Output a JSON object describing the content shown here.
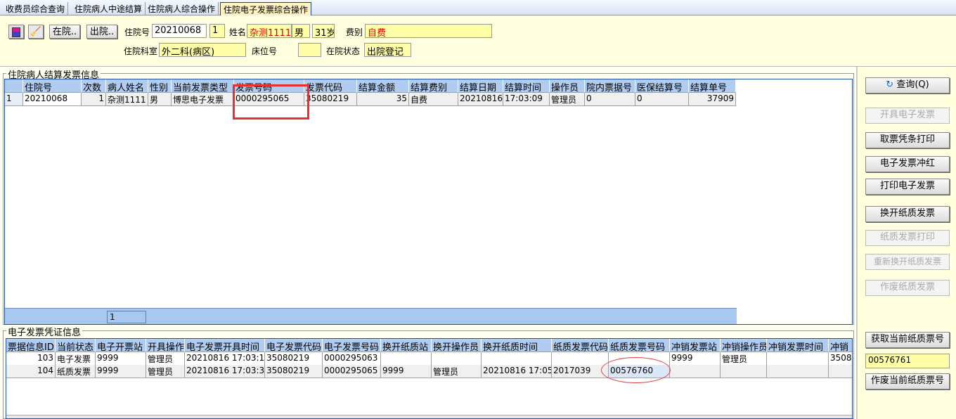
{
  "tabs": [
    "收费员综合查询",
    "住院病人中途结算",
    "住院病人综合操作",
    "住院电子发票综合操作"
  ],
  "active_tab": 3,
  "header": {
    "btn_in": "在院..",
    "btn_out": "出院..",
    "lbl_id": "住院号",
    "id": "20210068",
    "times": "1",
    "lbl_name": "姓名",
    "name": "杂测1111",
    "sex": "男",
    "age": "31岁",
    "lbl_fee": "费别",
    "fee": "自费",
    "lbl_dept": "住院科室",
    "dept": "外二科(病区)",
    "lbl_bed": "床位号",
    "bed": "",
    "lbl_status": "在院状态",
    "status": "出院登记"
  },
  "top_grid": {
    "title": "住院病人结算发票信息",
    "columns": [
      "",
      "住院号",
      "次数",
      "病人姓名",
      "性别",
      "当前发票类型",
      "发票号码",
      "发票代码",
      "结算金额",
      "结算费别",
      "结算日期",
      "结算时间",
      "操作员",
      "院内票据号",
      "医保结算号",
      "结算单号"
    ],
    "rows": [
      [
        "1",
        "20210068",
        "1",
        "杂测1111",
        "男",
        "博思电子发票",
        "0000295065",
        "35080219",
        "35",
        "自费",
        "20210816",
        "17:03:09",
        "管理员",
        "0",
        "0",
        "37909"
      ]
    ],
    "footer_count": "1"
  },
  "bottom_grid": {
    "title": "电子发票凭证信息",
    "columns": [
      "票据信息ID",
      "当前状态",
      "电子开票站",
      "开具操作",
      "电子发票开具时间",
      "电子发票代码",
      "电子发票号码",
      "换开纸质站",
      "换开操作员",
      "换开纸质时间",
      "纸质发票代码",
      "纸质发票号码",
      "冲销发票站",
      "冲销操作员",
      "冲销发票时间",
      "冲销"
    ],
    "rows": [
      [
        "103",
        "电子发票",
        "9999",
        "管理员",
        "20210816 17:03:1",
        "35080219",
        "0000295063",
        "",
        "",
        "",
        "",
        "",
        "9999",
        "管理员",
        "",
        "3508"
      ],
      [
        "104",
        "纸质发票",
        "9999",
        "管理员",
        "20210816 17:03:3",
        "35080219",
        "0000295065",
        "9999",
        "管理员",
        "20210816 17:05",
        "2017039",
        "00576760",
        "",
        "",
        "",
        ""
      ]
    ]
  },
  "side": {
    "query": "查询(Q)",
    "issue": "开具电子发票",
    "print_slip": "取票凭条打印",
    "red": "电子发票冲红",
    "print_e": "打印电子发票",
    "swap": "换开纸质发票",
    "print_paper": "纸质发票打印",
    "reswap": "重新换开纸质发票",
    "void_paper": "作废纸质发票",
    "get_no": "获取当前纸质票号",
    "cur_no": "00576761",
    "void_no": "作废当前纸质票号"
  },
  "colors": {
    "grid_header": "#b0ccf0",
    "field": "#ffffa8",
    "panel": "#ffffe0",
    "highlight": "#e00000"
  }
}
